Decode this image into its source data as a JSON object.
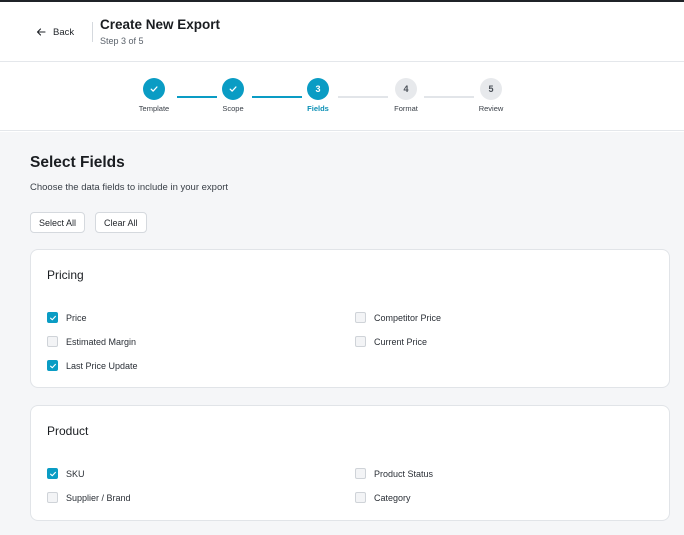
{
  "header": {
    "back_label": "Back",
    "title": "Create New Export",
    "subtitle": "Step 3 of 5"
  },
  "stepper": {
    "steps": [
      {
        "number": "1",
        "label": "Template",
        "state": "done"
      },
      {
        "number": "2",
        "label": "Scope",
        "state": "done"
      },
      {
        "number": "3",
        "label": "Fields",
        "state": "active"
      },
      {
        "number": "4",
        "label": "Format",
        "state": "todo"
      },
      {
        "number": "5",
        "label": "Review",
        "state": "todo"
      }
    ]
  },
  "main": {
    "title": "Select Fields",
    "description": "Choose the data fields to include in your export",
    "select_all_label": "Select All",
    "clear_all_label": "Clear All"
  },
  "groups": [
    {
      "title": "Pricing",
      "fields": [
        {
          "label": "Price",
          "checked": true
        },
        {
          "label": "Competitor Price",
          "checked": false
        },
        {
          "label": "Estimated Margin",
          "checked": false
        },
        {
          "label": "Current Price",
          "checked": false
        },
        {
          "label": "Last Price Update",
          "checked": true
        }
      ]
    },
    {
      "title": "Product",
      "fields": [
        {
          "label": "SKU",
          "checked": true
        },
        {
          "label": "Product Status",
          "checked": false
        },
        {
          "label": "Supplier / Brand",
          "checked": false
        },
        {
          "label": "Category",
          "checked": false
        }
      ]
    }
  ],
  "colors": {
    "accent": "#0a9cc4",
    "page_background": "#f5f6f8",
    "card_border": "#e1e4e8"
  },
  "icons": {
    "back": "arrow-left-icon",
    "step_done": "check-icon",
    "checkbox_checked": "check-icon"
  }
}
